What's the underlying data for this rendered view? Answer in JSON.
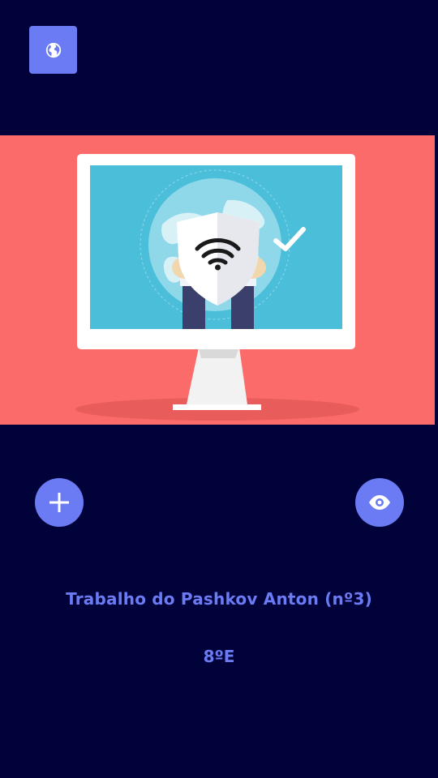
{
  "header": {
    "globe_button_icon": "globe-icon"
  },
  "hero": {
    "illustration": "monitor-vpn-shield-illustration"
  },
  "actions": {
    "add_icon": "plus-icon",
    "view_icon": "eye-icon"
  },
  "content": {
    "title": "Trabalho do Pashkov Anton (nº3)",
    "subtitle": "8ºE"
  },
  "colors": {
    "background": "#02023a",
    "accent": "#6b7bf3",
    "hero_background": "#fb6b6a"
  }
}
